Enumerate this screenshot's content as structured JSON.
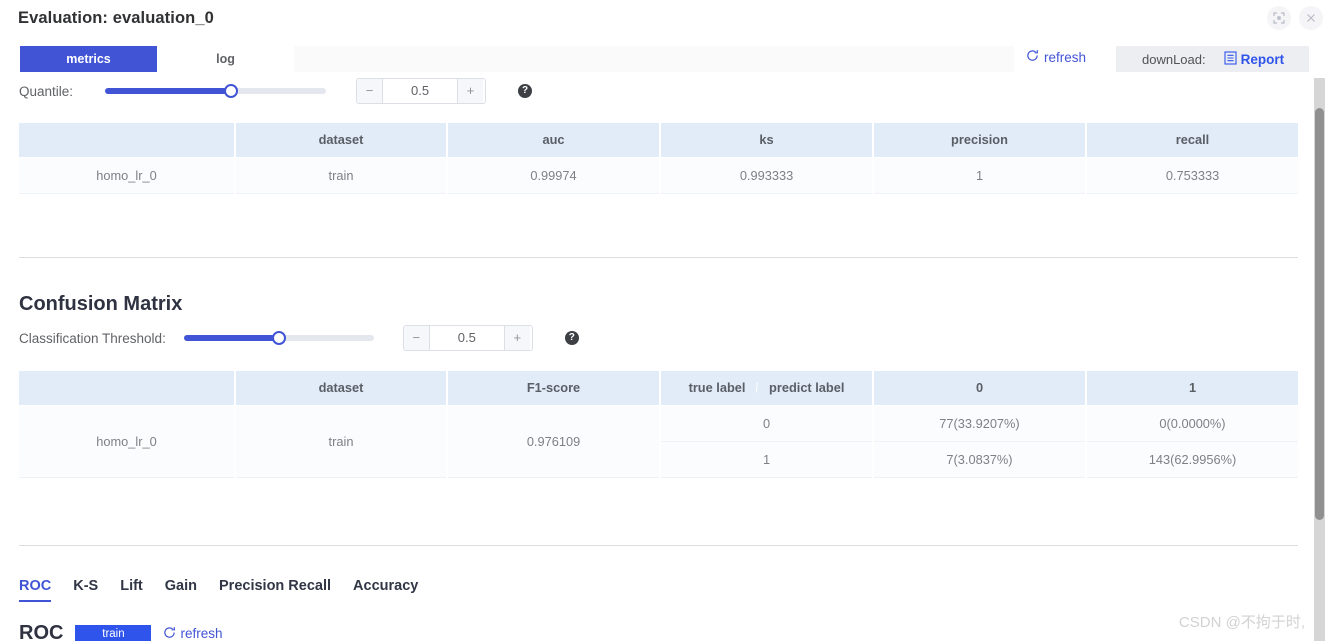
{
  "header": {
    "title": "Evaluation: evaluation_0",
    "expand_icon": "expand-icon",
    "close_icon": "close-icon"
  },
  "tabs": {
    "items": [
      {
        "label": "metrics",
        "active": true
      },
      {
        "label": "log",
        "active": false
      }
    ],
    "refresh_label": "refresh",
    "refresh_icon": "refresh-icon",
    "download_label": "downLoad:",
    "report_label": "Report",
    "report_icon": "document-icon"
  },
  "quantile": {
    "label": "Quantile:",
    "value": "0.5",
    "percent": 57,
    "minus": "−",
    "plus": "+",
    "help_icon": "help-icon"
  },
  "metrics_table": {
    "columns": [
      "",
      "dataset",
      "auc",
      "ks",
      "precision",
      "recall"
    ],
    "rows": [
      {
        "name": "homo_lr_0",
        "dataset": "train",
        "auc": "0.99974",
        "ks": "0.993333",
        "precision": "1",
        "recall": "0.753333"
      }
    ]
  },
  "confusion": {
    "title": "Confusion Matrix",
    "threshold_label": "Classification Threshold:",
    "threshold_value": "0.5",
    "threshold_percent": 50,
    "minus": "−",
    "plus": "+",
    "help_icon": "help-icon",
    "columns": [
      "",
      "dataset",
      "F1-score",
      "true label",
      "predict label",
      "0",
      "1"
    ],
    "model": "homo_lr_0",
    "dataset": "train",
    "f1_score": "0.976109",
    "matrix_rows": [
      {
        "true_label": "0",
        "pred_0": "77(33.9207%)",
        "pred_1": "0(0.0000%)"
      },
      {
        "true_label": "1",
        "pred_0": "7(3.0837%)",
        "pred_1": "143(62.9956%)"
      }
    ]
  },
  "bottom_tabs": {
    "items": [
      {
        "label": "ROC",
        "active": true
      },
      {
        "label": "K-S",
        "active": false
      },
      {
        "label": "Lift",
        "active": false
      },
      {
        "label": "Gain",
        "active": false
      },
      {
        "label": "Precision Recall",
        "active": false
      },
      {
        "label": "Accuracy",
        "active": false
      }
    ]
  },
  "roc_section": {
    "title": "ROC",
    "pill_label": "train",
    "refresh_label": "refresh",
    "refresh_icon": "refresh-icon"
  },
  "watermark": {
    "text": "CSDN @不拘于时,"
  },
  "colors": {
    "accent": "#4254d6",
    "link": "#2f54eb",
    "table_header": "#e2ebf8",
    "table_cell": "#fbfcfe",
    "rail": "#e4e7ed"
  }
}
